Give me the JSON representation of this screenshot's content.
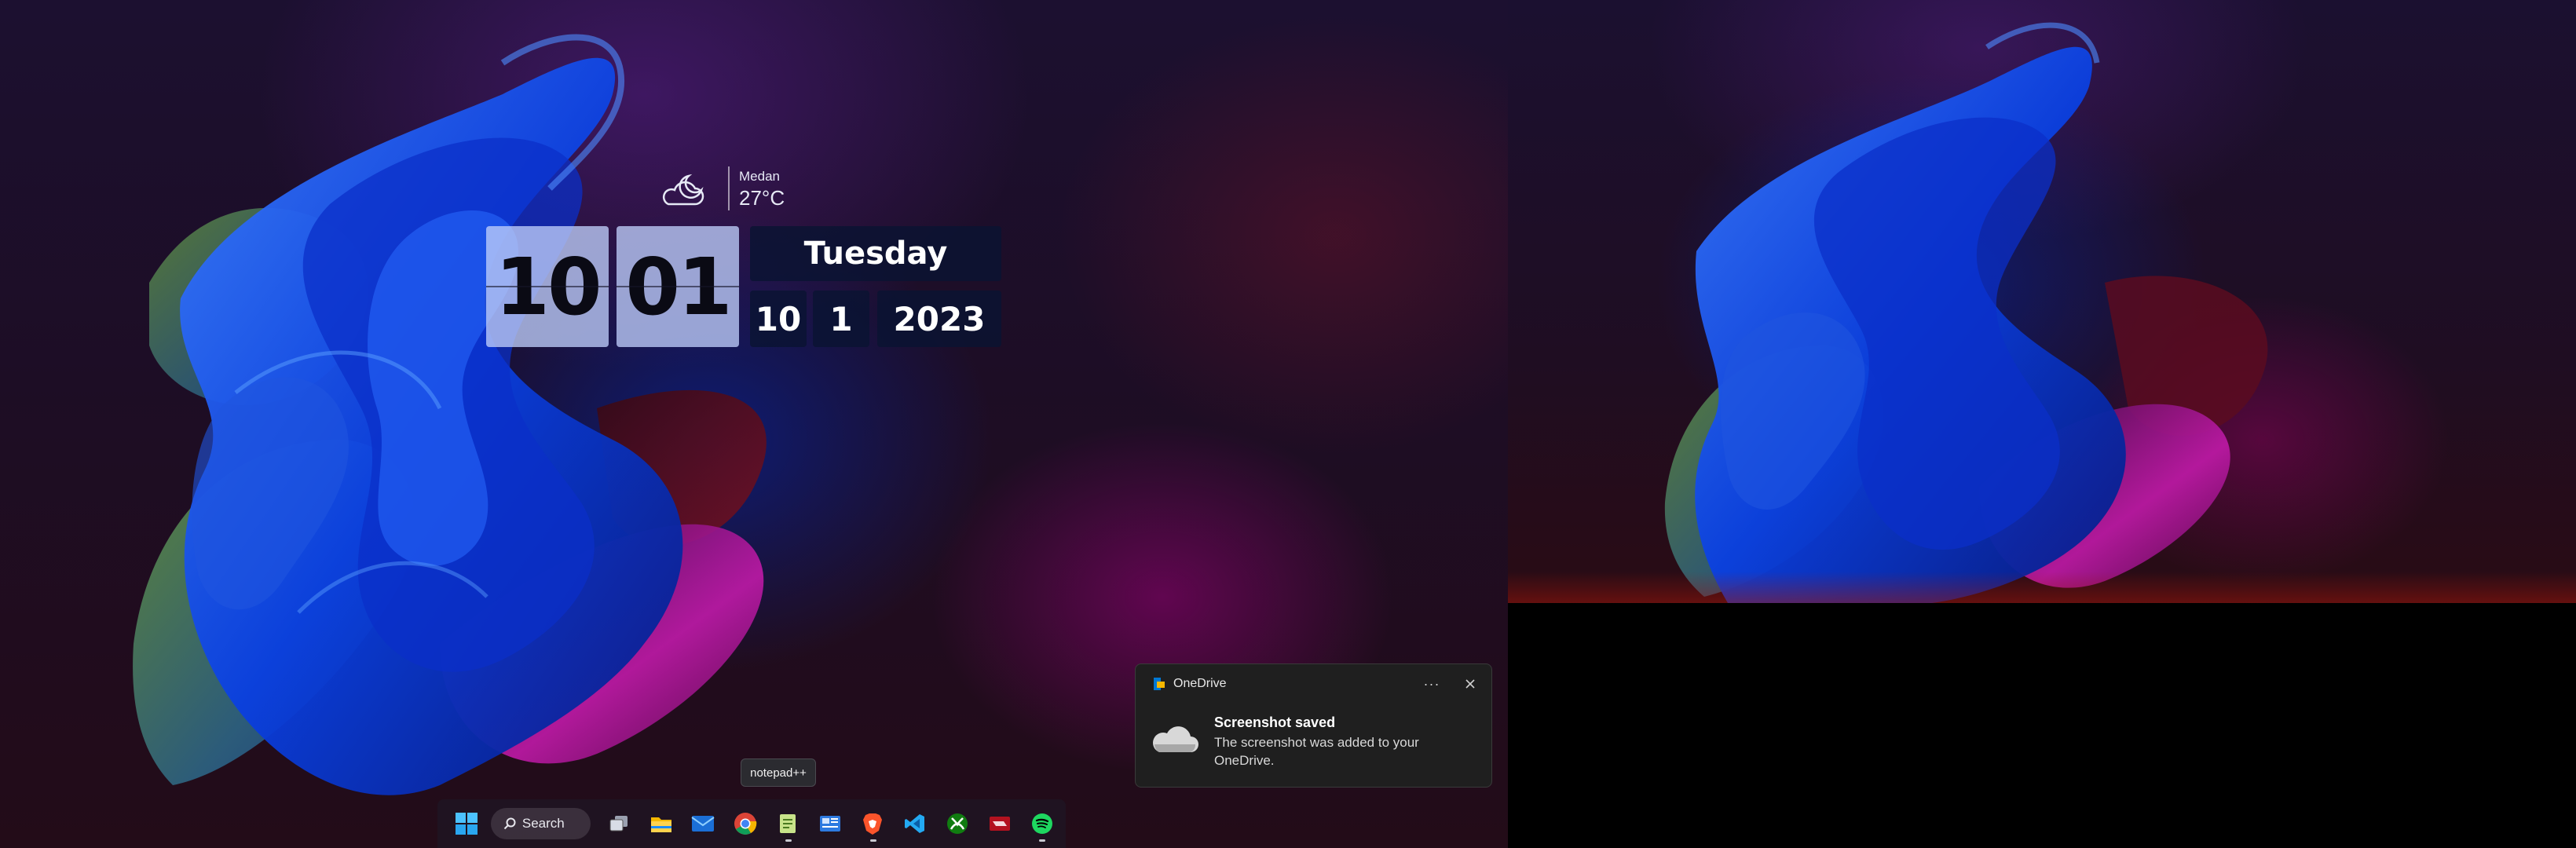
{
  "widget": {
    "weather_city": "Medan",
    "weather_temp": "27°C",
    "weather_icon": "partly-cloudy-night-icon",
    "clock_hours": "10",
    "clock_minutes": "01",
    "day_name": "Tuesday",
    "date_month": "10",
    "date_day": "1",
    "date_year": "2023"
  },
  "taskbar": {
    "search_label": "Search",
    "tooltip": "notepad++",
    "apps": [
      {
        "name": "start-button",
        "icon": "windows-logo-icon"
      },
      {
        "name": "task-view-button",
        "icon": "task-view-icon"
      },
      {
        "name": "file-explorer-button",
        "icon": "folder-icon"
      },
      {
        "name": "mail-button",
        "icon": "mail-icon"
      },
      {
        "name": "chrome-button",
        "icon": "chrome-icon"
      },
      {
        "name": "notepadpp-button",
        "icon": "notepad-icon"
      },
      {
        "name": "news-button",
        "icon": "newspaper-icon"
      },
      {
        "name": "brave-button",
        "icon": "brave-lion-icon"
      },
      {
        "name": "vscode-button",
        "icon": "vscode-icon"
      },
      {
        "name": "xbox-button",
        "icon": "xbox-icon"
      },
      {
        "name": "app-red-button",
        "icon": "red-app-icon"
      },
      {
        "name": "spotify-button",
        "icon": "spotify-icon"
      }
    ]
  },
  "toast": {
    "app_name": "OneDrive",
    "title": "Screenshot saved",
    "body": "The screenshot was added to your OneDrive.",
    "more_label": "···",
    "accent": "#0078d4"
  },
  "colors": {
    "flip_tile": "#bccdfa",
    "date_tile": "#0a1432",
    "toast_bg": "#1f1f1f"
  }
}
